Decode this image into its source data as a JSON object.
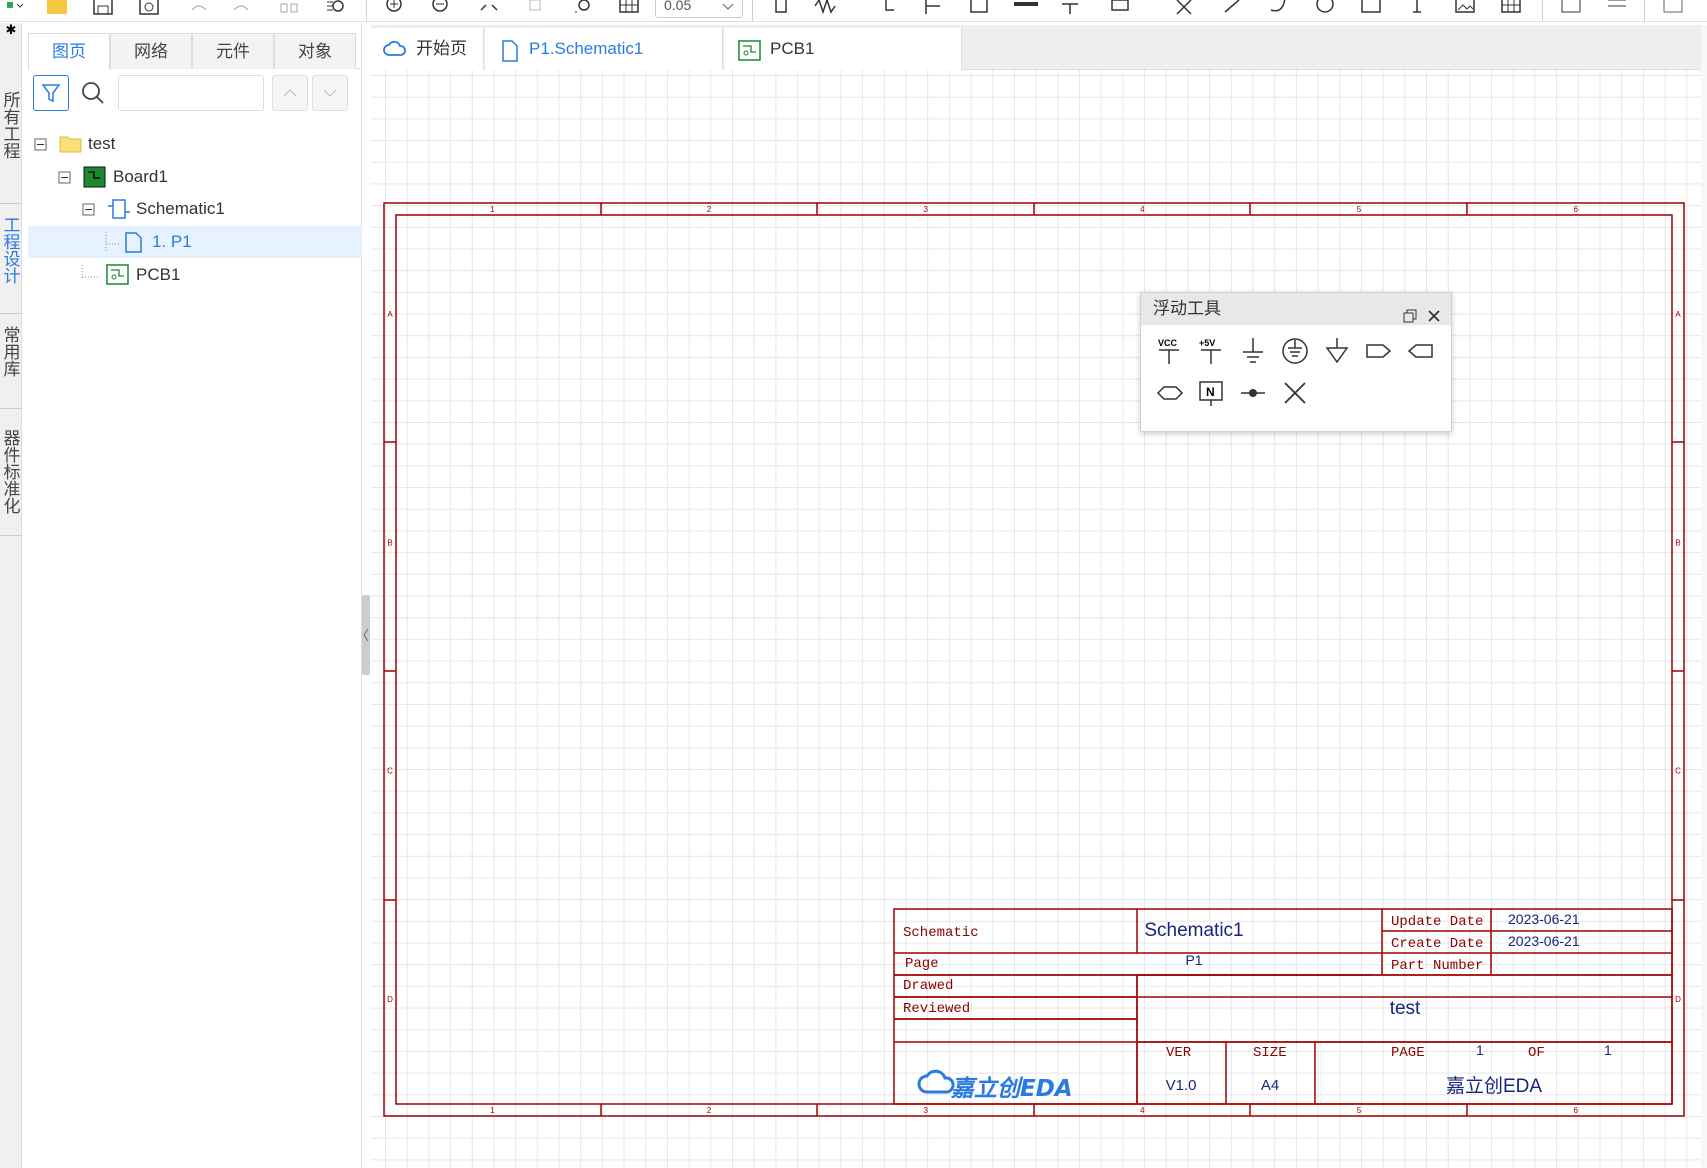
{
  "toolbar": {
    "zoom_value": "0.05",
    "icons": [
      "new-project-icon",
      "open-folder-icon",
      "save-icon",
      "history-icon",
      "undo-icon",
      "redo-icon",
      "component-icon",
      "find-icon",
      "zoom-in-icon",
      "zoom-out-icon",
      "fit-icon",
      "zoom-area-icon",
      "search-area-icon",
      "grid-icon",
      "chip-icon",
      "resistor-icon",
      "pin-icon",
      "flag-icon",
      "netlabel-icon",
      "bus-icon",
      "junction-icon",
      "entry-icon",
      "line-icon",
      "line2-icon",
      "arc-icon",
      "circle-icon",
      "rect-icon",
      "text-icon",
      "image-icon",
      "table-icon",
      "tool1-icon",
      "tool2-icon",
      "window-icon"
    ]
  },
  "left_strip": {
    "tabs": [
      "所有工程",
      "工程设计",
      "常用库",
      "器件标准化"
    ],
    "active_index": 1
  },
  "panel": {
    "tabs": [
      "图页",
      "网络",
      "元件",
      "对象"
    ],
    "active_tab": 0,
    "search": {
      "placeholder": "",
      "value": ""
    },
    "tree": [
      {
        "label": "test",
        "type": "folder",
        "level": 0
      },
      {
        "label": "Board1",
        "type": "board",
        "level": 1
      },
      {
        "label": "Schematic1",
        "type": "schematic",
        "level": 2
      },
      {
        "label": "1. P1",
        "type": "page",
        "level": 3,
        "selected": true
      },
      {
        "label": "PCB1",
        "type": "pcb",
        "level": 2
      }
    ]
  },
  "doc_tabs": [
    {
      "label": "开始页",
      "icon": "cloud-icon"
    },
    {
      "label": "P1.Schematic1",
      "icon": "page-icon",
      "active": true
    },
    {
      "label": "PCB1",
      "icon": "pcb-icon"
    }
  ],
  "floating_tools": {
    "title": "浮动工具",
    "items": [
      "vcc-icon",
      "plus5v-icon",
      "ground-icon",
      "earth-icon",
      "signal-ground-icon",
      "net-port-in-icon",
      "net-port-out-icon",
      "net-port-bidi-icon",
      "no-connect-flag-icon",
      "junction-dot-icon",
      "no-connect-icon"
    ]
  },
  "drawing": {
    "col_labels": [
      "1",
      "2",
      "3",
      "4",
      "5",
      "6"
    ],
    "row_labels": [
      "A",
      "B",
      "C",
      "D"
    ],
    "title_block": {
      "schematic_label": "Schematic",
      "schematic_value": "Schematic1",
      "page_label": "Page",
      "page_value": "P1",
      "drawed_label": "Drawed",
      "reviewed_label": "Reviewed",
      "update_date_label": "Update Date",
      "update_date": "2023-06-21",
      "create_date_label": "Create Date",
      "create_date": "2023-06-21",
      "part_number_label": "Part Number",
      "project_name": "test",
      "ver_label": "VER",
      "ver_value": "V1.0",
      "size_label": "SIZE",
      "size_value": "A4",
      "page_num_label": "PAGE",
      "page_num": "1",
      "of_label": "OF",
      "of_value": "1",
      "company": "嘉立创EDA",
      "logo_text": "嘉立创EDA"
    }
  },
  "colors": {
    "accent": "#2a7ae2",
    "frame": "#a00000",
    "title_value": "#1a237e"
  }
}
